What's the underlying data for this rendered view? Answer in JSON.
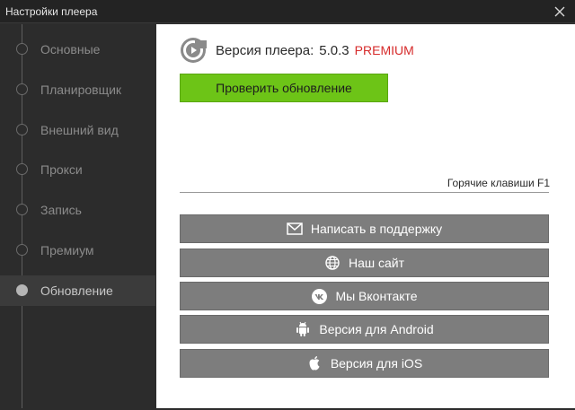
{
  "window": {
    "title": "Настройки плеера"
  },
  "sidebar": {
    "items": [
      {
        "label": "Основные",
        "active": false
      },
      {
        "label": "Планировщик",
        "active": false
      },
      {
        "label": "Внешний вид",
        "active": false
      },
      {
        "label": "Прокси",
        "active": false
      },
      {
        "label": "Запись",
        "active": false
      },
      {
        "label": "Премиум",
        "active": false
      },
      {
        "label": "Обновление",
        "active": true
      }
    ]
  },
  "update": {
    "version_label": "Версия плеера:",
    "version_number": "5.0.3",
    "edition": "PREMIUM",
    "check_button": "Проверить обновление",
    "hotkeys_hint": "Горячие клавиши F1"
  },
  "links": [
    {
      "label": "Написать в поддержку",
      "icon": "envelope-icon"
    },
    {
      "label": "Наш сайт",
      "icon": "globe-icon"
    },
    {
      "label": "Мы Вконтакте",
      "icon": "vk-icon"
    },
    {
      "label": "Версия для Android",
      "icon": "android-icon"
    },
    {
      "label": "Версия для iOS",
      "icon": "apple-icon"
    }
  ],
  "colors": {
    "accent_green": "#6dc417",
    "premium_red": "#d62b2b",
    "sidebar_bg": "#2c2c2c",
    "link_button_bg": "#7d7d7d"
  }
}
